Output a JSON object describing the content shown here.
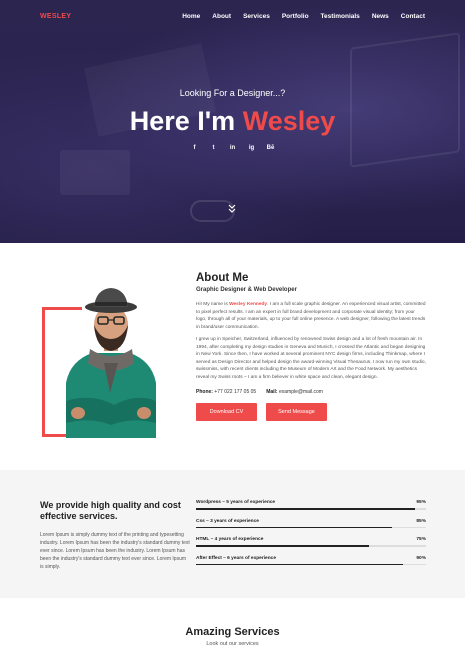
{
  "nav": {
    "logo": "WESLEY",
    "items": [
      "Home",
      "About",
      "Services",
      "Portfolio",
      "Testimonials",
      "News",
      "Contact"
    ]
  },
  "hero": {
    "subtitle": "Looking For a Designer...?",
    "title_prefix": "Here I'm ",
    "title_name": "Wesley",
    "socials": [
      "f",
      "t",
      "in",
      "ig",
      "Bē"
    ],
    "social_icons": [
      "facebook-icon",
      "twitter-icon",
      "linkedin-icon",
      "instagram-icon",
      "behance-icon"
    ]
  },
  "about": {
    "title": "About Me",
    "role": "Graphic Designer & Web Developer",
    "p1_start": "Hi! My name is ",
    "p1_name": "Wesley Kennedy",
    "p1_end": ". I am a full scale graphic designer. An experienced visual artist, committed to pixel perfect results. I am an expert in full brand development and corporate visual identity; from your logo, through all of your materials, up to your full online presence. A web designer, following the latest trends in brand/user communication.",
    "p2": "I grew up in Speicher, Switzerland, influenced by renowned Swiss design and a lot of fresh mountain air. In 1994, after completing my design studies in Geneva and Munich, I crossed the Atlantic and began designing in New York. Since then, I have worked at several prominent NYC design firms, including Thinkmap, where I served as Design Director and helped design the award-winning Visual Thesaurus. I now run my own studio, swissmiss, with recent clients including the Museum of Modern Art and the Food Network. My aesthetics reveal my Swiss roots – I am a firm believer in white space and clean, elegant design.",
    "phone_label": "Phone:",
    "phone": "+77 022 177 05 05",
    "mail_label": "Mail:",
    "mail": "example@mail.com",
    "btn_download": "Download CV",
    "btn_message": "Send Message"
  },
  "skills": {
    "heading": "We provide high quality and cost effective services.",
    "body": "Lorem Ipsum is simply dummy text of the printing and typesetting industry. Lorem Ipsum has been the industry's standard dummy text ever since. Lorem Ipsum has been the industry. Lorem Ipsum has been the industry's standard dummy text ever since. Lorem Ipsum is simply.",
    "items": [
      {
        "label": "Wordpress – 5 years of experience",
        "percent_label": "95%",
        "percent": 95
      },
      {
        "label": "Css – 3 years of experience",
        "percent_label": "85%",
        "percent": 85
      },
      {
        "label": "HTML – 4 years of experience",
        "percent_label": "75%",
        "percent": 75
      },
      {
        "label": "After Effect – 6 years of experience",
        "percent_label": "90%",
        "percent": 90
      }
    ]
  },
  "services": {
    "title": "Amazing Services",
    "subtitle": "Look out our services"
  },
  "colors": {
    "accent": "#ef4b4b",
    "hero_bg": "#2a2350"
  }
}
